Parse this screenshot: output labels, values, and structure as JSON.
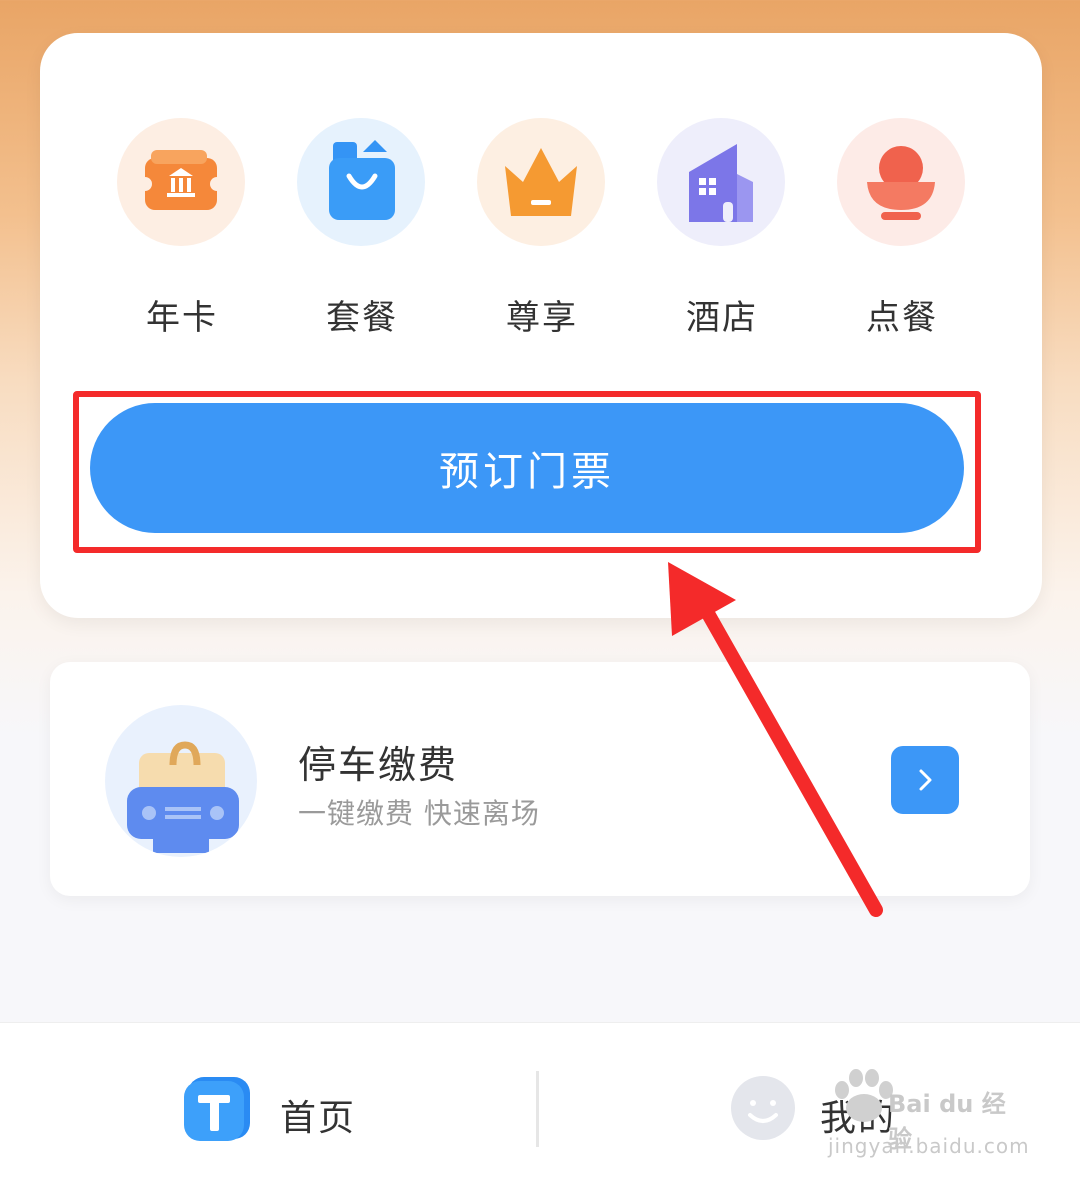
{
  "quick_menu": {
    "items": [
      {
        "label": "年卡",
        "icon": "annual-card-icon",
        "color": "#f5883a"
      },
      {
        "label": "套餐",
        "icon": "shopping-bag-icon",
        "color": "#3494f5"
      },
      {
        "label": "尊享",
        "icon": "crown-icon",
        "color": "#f59a32"
      },
      {
        "label": "酒店",
        "icon": "hotel-icon",
        "color": "#7c76e8"
      },
      {
        "label": "点餐",
        "icon": "food-bowl-icon",
        "color": "#f0624d"
      }
    ]
  },
  "book_button": {
    "label": "预订门票",
    "color": "#3c97f7"
  },
  "parking": {
    "title": "停车缴费",
    "subtitle": "一键缴费 快速离场",
    "icon": "parking-car-icon"
  },
  "tabbar": {
    "home": {
      "label": "首页",
      "icon": "home-tab-icon"
    },
    "mine": {
      "label": "我的",
      "icon": "smiley-avatar-icon"
    }
  },
  "watermark": {
    "brand": "Bai du 经验",
    "url": "jingyan.baidu.com"
  },
  "annotation": {
    "highlight_color": "#f42a2a"
  }
}
